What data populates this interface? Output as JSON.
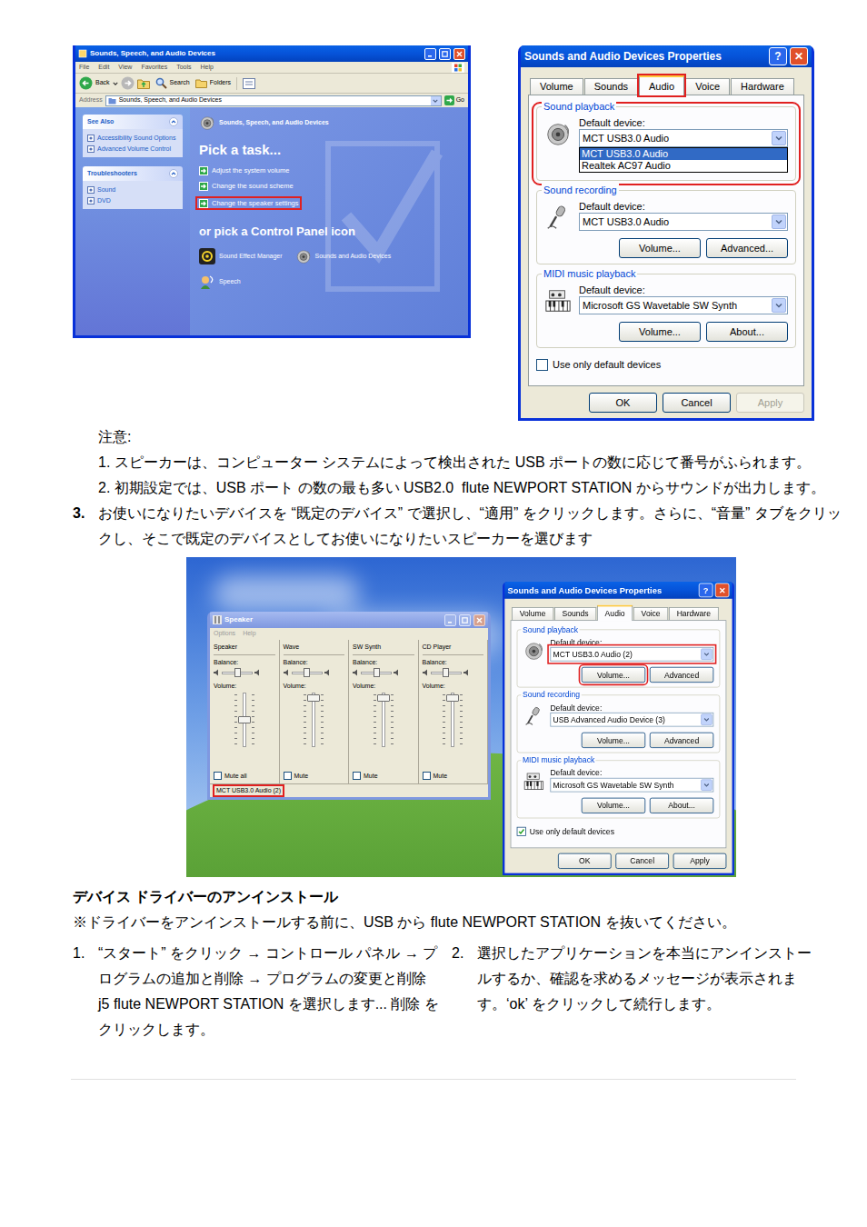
{
  "control_panel": {
    "title": "Sounds, Speech, and Audio Devices",
    "menu": [
      "File",
      "Edit",
      "View",
      "Favorites",
      "Tools",
      "Help"
    ],
    "toolbar": [
      "Back",
      "Search",
      "Folders"
    ],
    "address_label": "Address",
    "address": "Sounds, Speech, and Audio Devices",
    "go": "Go",
    "side_panels": [
      {
        "title": "See Also",
        "items": [
          "Accessibility Sound Options",
          "Advanced Volume Control"
        ]
      },
      {
        "title": "Troubleshooters",
        "items": [
          "Sound",
          "DVD"
        ]
      }
    ],
    "header": "Sounds, Speech, and Audio Devices",
    "pick_task": "Pick a task...",
    "tasks": [
      {
        "label": "Adjust the system volume",
        "highlighted": false
      },
      {
        "label": "Change the sound scheme",
        "highlighted": false
      },
      {
        "label": "Change the speaker settings",
        "highlighted": true
      }
    ],
    "pick_icon": "or pick a Control Panel icon",
    "icons": [
      "Sound Effect Manager",
      "Sounds and Audio Devices",
      "Speech"
    ]
  },
  "dialog_top": {
    "title": "Sounds and Audio Devices Properties",
    "title_buttons": [
      "?",
      "✕"
    ],
    "tabs": [
      {
        "label": "Volume",
        "selected": false,
        "highlighted": false
      },
      {
        "label": "Sounds",
        "selected": false,
        "highlighted": false
      },
      {
        "label": "Audio",
        "selected": true,
        "highlighted": true
      },
      {
        "label": "Voice",
        "selected": false,
        "highlighted": false
      },
      {
        "label": "Hardware",
        "selected": false,
        "highlighted": false
      }
    ],
    "groups": [
      {
        "title": "Sound playback",
        "label": "Default device:",
        "value": "MCT USB3.0 Audio",
        "highlighted": true,
        "select_highlighted": false,
        "options": [
          {
            "label": "MCT USB3.0 Audio",
            "selected": true
          },
          {
            "label": "Realtek AC97 Audio",
            "selected": false
          }
        ],
        "buttons": []
      },
      {
        "title": "Sound recording",
        "label": "Default device:",
        "value": "MCT USB3.0 Audio",
        "highlighted": false,
        "select_highlighted": false,
        "options": [],
        "buttons": [
          {
            "label": "Volume...",
            "highlighted": false
          },
          {
            "label": "Advanced...",
            "highlighted": false
          }
        ]
      },
      {
        "title": "MIDI music playback",
        "label": "Default device:",
        "value": "Microsoft GS Wavetable SW Synth",
        "highlighted": false,
        "select_highlighted": false,
        "options": [],
        "buttons": [
          {
            "label": "Volume...",
            "highlighted": false
          },
          {
            "label": "About...",
            "highlighted": false
          }
        ]
      }
    ],
    "checkbox": {
      "label": "Use only default devices",
      "checked": false
    },
    "buttons": [
      {
        "label": "OK",
        "disabled": false
      },
      {
        "label": "Cancel",
        "disabled": false
      },
      {
        "label": "Apply",
        "disabled": true
      }
    ]
  },
  "notes": {
    "title": "注意:",
    "items": [
      "1. スピーカーは、コンピューター システムによって検出された USB ポートの数に応じて番号がふられます。",
      "2. 初期設定では、USB ポート の数の最も多い USB2.0  flute NEWPORT STATION からサウンドが出力します。"
    ]
  },
  "step3": {
    "number": "3.",
    "text": "お使いになりたいデバイスを “既定のデバイス” で選択し、“適用” をクリックします。さらに、“音量” タブをクリックし、そこで既定のデバイスとしてお使いになりたいスピーカーを選びます"
  },
  "desktop": {
    "mixer": {
      "title": "Speaker",
      "menu": [
        "Options",
        "Help"
      ],
      "balance_label": "Balance:",
      "volume_label": "Volume:",
      "channels": [
        {
          "name": "Speaker",
          "mute_label": "Mute all",
          "muted": false,
          "balance": 0.5,
          "level": 0.5
        },
        {
          "name": "Wave",
          "mute_label": "Mute",
          "muted": false,
          "balance": 0.5,
          "level": 0.92
        },
        {
          "name": "SW Synth",
          "mute_label": "Mute",
          "muted": false,
          "balance": 0.5,
          "level": 0.92
        },
        {
          "name": "CD Player",
          "mute_label": "Mute",
          "muted": false,
          "balance": 0.5,
          "level": 0.92
        }
      ],
      "footer": "MCT USB3.0 Audio (2)",
      "footer_highlighted": true
    },
    "dialog": {
      "title": "Sounds and Audio Devices Properties",
      "title_buttons": [
        "?",
        "✕"
      ],
      "tabs": [
        {
          "label": "Volume",
          "selected": false,
          "highlighted": false
        },
        {
          "label": "Sounds",
          "selected": false,
          "highlighted": false
        },
        {
          "label": "Audio",
          "selected": true,
          "highlighted": false
        },
        {
          "label": "Voice",
          "selected": false,
          "highlighted": false
        },
        {
          "label": "Hardware",
          "selected": false,
          "highlighted": false
        }
      ],
      "groups": [
        {
          "title": "Sound playback",
          "label": "Default device:",
          "value": "MCT USB3.0 Audio (2)",
          "highlighted": false,
          "select_highlighted": true,
          "options": [],
          "buttons": [
            {
              "label": "Volume...",
              "highlighted": true
            },
            {
              "label": "Advanced",
              "highlighted": false
            }
          ]
        },
        {
          "title": "Sound recording",
          "label": "Default device:",
          "value": "USB Advanced Audio Device (3)",
          "highlighted": false,
          "select_highlighted": false,
          "options": [],
          "buttons": [
            {
              "label": "Volume...",
              "highlighted": false
            },
            {
              "label": "Advanced",
              "highlighted": false
            }
          ]
        },
        {
          "title": "MIDI music playback",
          "label": "Default device:",
          "value": "Microsoft GS Wavetable SW Synth",
          "highlighted": false,
          "select_highlighted": false,
          "options": [],
          "buttons": [
            {
              "label": "Volume...",
              "highlighted": false
            },
            {
              "label": "About...",
              "highlighted": false
            }
          ]
        }
      ],
      "checkbox": {
        "label": "Use only default devices",
        "checked": true
      },
      "buttons": [
        {
          "label": "OK",
          "disabled": false
        },
        {
          "label": "Cancel",
          "disabled": false
        },
        {
          "label": "Apply",
          "disabled": false
        }
      ]
    }
  },
  "uninstall": {
    "heading": "デバイス ドライバーのアンインストール",
    "note": "※ドライバーをアンインストールする前に、USB から flute NEWPORT STATION を抜いてください。",
    "steps": [
      {
        "number": "1.",
        "text": "“スタート” をクリック → コントロール パネル → プログラムの追加と削除 → プログラムの変更と削除 j5 flute NEWPORT STATION を選択します... 削除 をクリックします。"
      },
      {
        "number": "2.",
        "text": "選択したアプリケーションを本当にアンインストールするか、確認を求めるメッセージが表示されます。‘ok’ をクリックして続行します。"
      }
    ]
  }
}
